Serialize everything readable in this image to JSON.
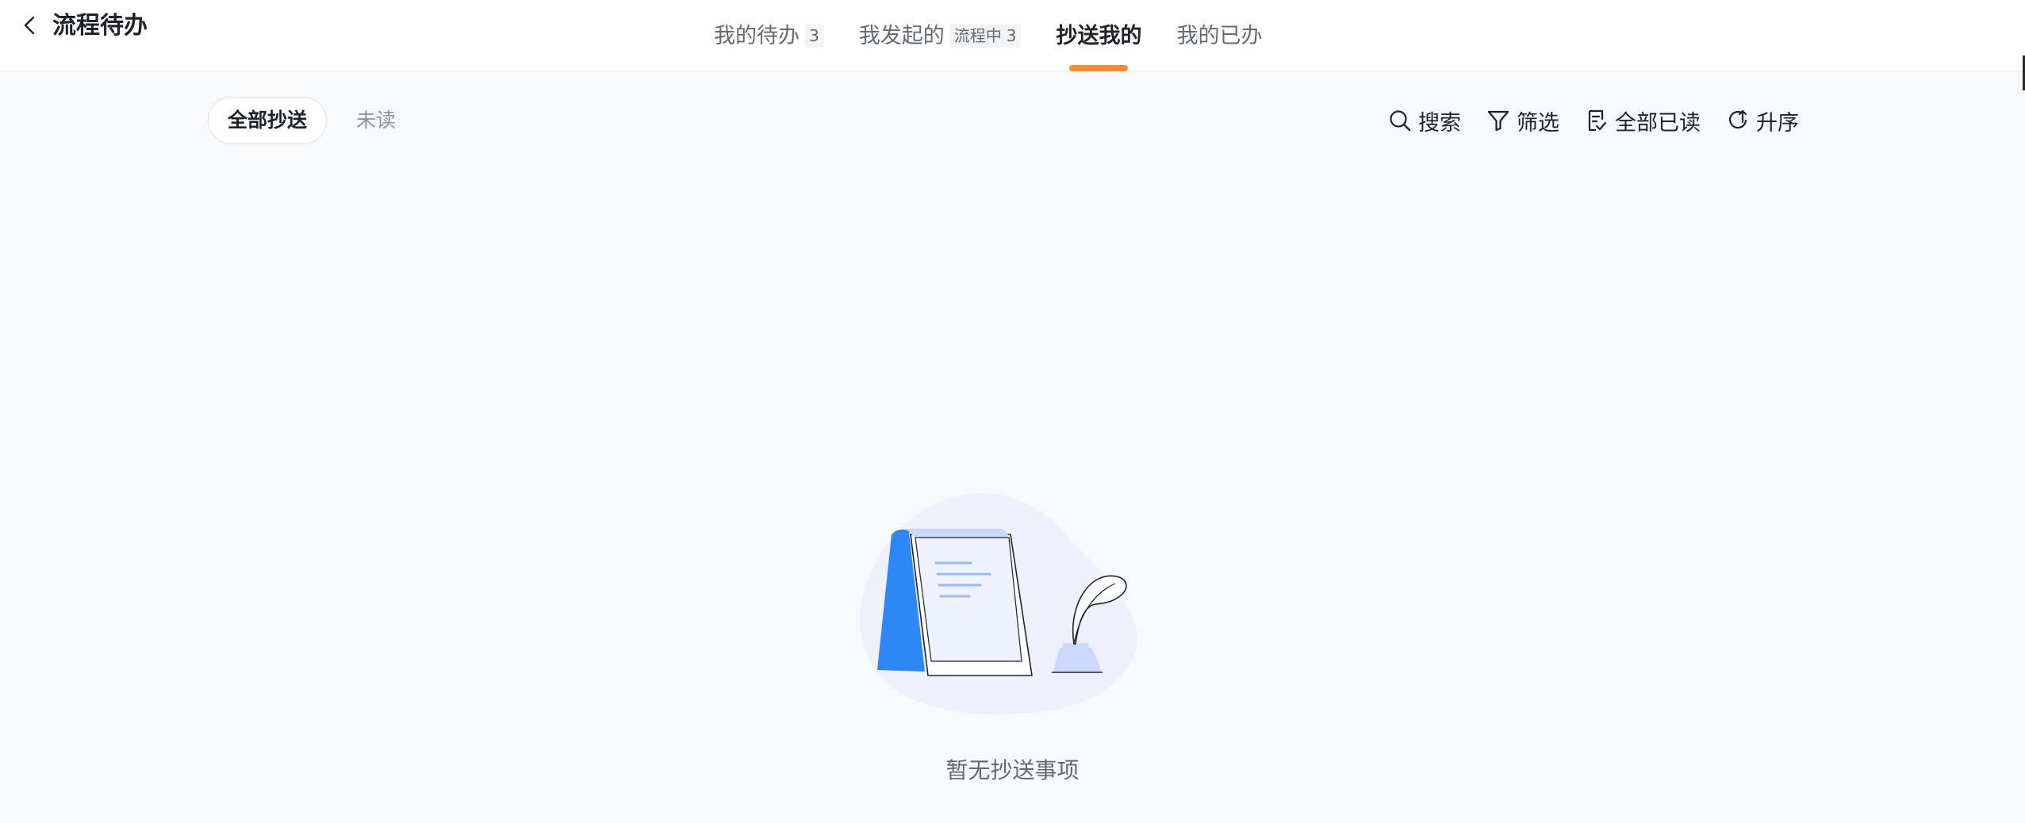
{
  "header": {
    "back_icon": "chevron-left-icon",
    "title": "流程待办",
    "tabs": [
      {
        "label": "我的待办",
        "badge": "3"
      },
      {
        "label": "我发起的",
        "badge_text": "流程中",
        "badge": "3"
      },
      {
        "label": "抄送我的",
        "active": true
      },
      {
        "label": "我的已办"
      }
    ],
    "accent_color": "#ff8a2b"
  },
  "toolbar": {
    "filters": [
      {
        "label": "全部抄送",
        "active": true
      },
      {
        "label": "未读"
      }
    ],
    "actions": [
      {
        "icon": "search-icon",
        "label": "搜索"
      },
      {
        "icon": "filter-icon",
        "label": "筛选"
      },
      {
        "icon": "mark-read-icon",
        "label": "全部已读"
      },
      {
        "icon": "sort-icon",
        "label": "升序"
      }
    ]
  },
  "empty_state": {
    "illustration": "notebook-quill-illustration",
    "text": "暂无抄送事项"
  }
}
